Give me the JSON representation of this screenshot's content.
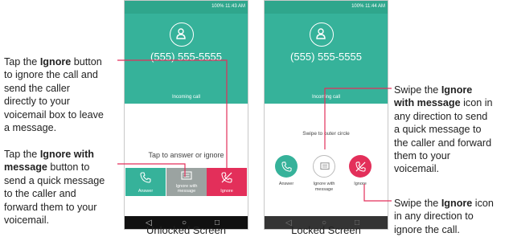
{
  "status": {
    "unlocked_time": "100% 11:43 AM",
    "locked_time": "100% 11:44 AM"
  },
  "call": {
    "number": "(555) 555-5555",
    "incoming": "Incoming call"
  },
  "unlocked": {
    "tap_hint": "Tap to answer or ignore",
    "answer": "Answer",
    "ignore_msg_1": "Ignore with",
    "ignore_msg_2": "message",
    "ignore": "Ignore",
    "caption": "Unlocked Screen"
  },
  "locked": {
    "swipe_hint": "Swipe to outer circle",
    "answer": "Answer",
    "ignore_msg_1": "Ignore with",
    "ignore_msg_2": "message",
    "ignore": "Ignore",
    "caption": "Locked Screen"
  },
  "nav": {
    "back": "◁",
    "home": "○",
    "recent": "□"
  },
  "callouts": {
    "ignore": {
      "p1": "Tap the ",
      "b1": "Ignore",
      "p2": " button",
      "p3": "to ignore the call and",
      "p4": "send the caller",
      "p5": "directly to your",
      "p6": "voicemail box to leave",
      "p7": "a message."
    },
    "ignore_msg": {
      "p1": "Tap the ",
      "b1": "Ignore with",
      "b2": "message",
      "p2": " button to",
      "p3": "send a quick message",
      "p4": "to the caller and",
      "p5": "forward them to your",
      "p6": "voicemail."
    },
    "swipe_msg": {
      "p1": "Swipe the ",
      "b1": "Ignore",
      "b2": "with message",
      "p2": " icon in",
      "p3": "any direction to send",
      "p4": "a quick message to",
      "p5": "the caller and forward",
      "p6": "them to your",
      "p7": "voicemail."
    },
    "swipe_ignore": {
      "p1": "Swipe the ",
      "b1": "Ignore",
      "p2": " icon",
      "p3": "in any direction to",
      "p4": "ignore the call."
    }
  },
  "colors": {
    "green": "#36b29a",
    "green_dark": "#2fa68c",
    "gray": "#9ba3a1",
    "red": "#e32f5a"
  }
}
